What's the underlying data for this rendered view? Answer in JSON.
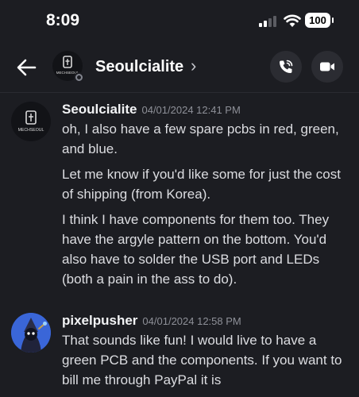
{
  "status_bar": {
    "time": "8:09",
    "battery": "100"
  },
  "header": {
    "title": "Seoulcialite",
    "chevron": "›",
    "avatar_label": "MECHSEOUL",
    "icons": [
      "back-arrow-icon",
      "phone-icon",
      "video-camera-icon"
    ]
  },
  "messages": [
    {
      "username": "Seoulcialite",
      "timestamp": "04/01/2024 12:41 PM",
      "avatar_label": "MECHSEOUL",
      "paragraphs": [
        "oh, I also have a few spare pcbs in red, green, and blue.",
        "Let me know if you'd like some for just the cost of shipping (from Korea).",
        "I think I have components for them too. They have the argyle pattern on the bottom. You'd also have to solder the USB port and LEDs (both a pain in the ass to do)."
      ]
    },
    {
      "username": "pixelpusher",
      "timestamp": "04/01/2024 12:58 PM",
      "paragraphs": [
        "That sounds like fun! I would live to have a green PCB and the components.  If you want to bill me through PayPal it is"
      ]
    }
  ],
  "colors": {
    "background": "#1c1d22",
    "button_bg": "#2b2c32",
    "text_primary": "#f2f3f5",
    "text_muted": "#8e9098"
  }
}
